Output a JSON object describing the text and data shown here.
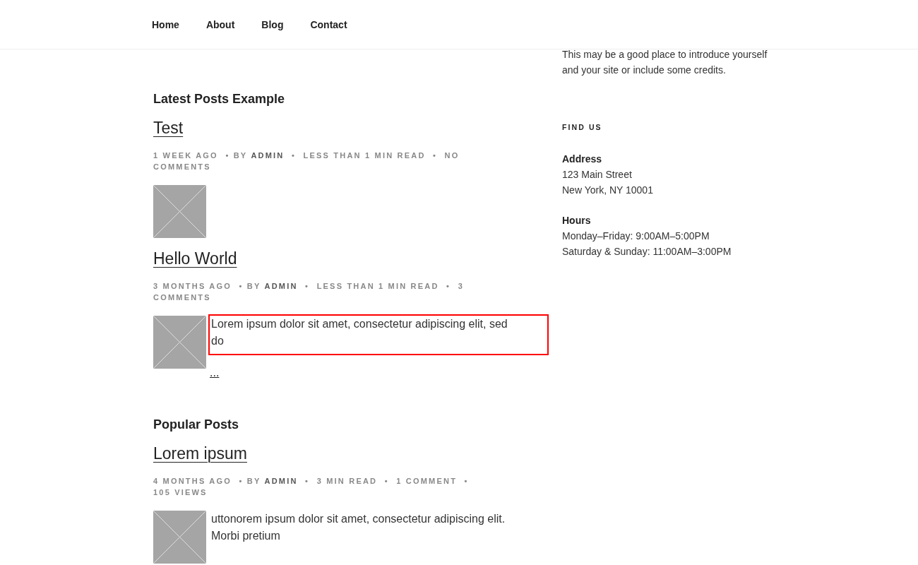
{
  "nav": {
    "items": [
      "Home",
      "About",
      "Blog",
      "Contact"
    ]
  },
  "sections": [
    {
      "heading": "Latest Posts Example",
      "posts": [
        {
          "title": "Test",
          "meta": "1 WEEK AGO  • BY **ADMIN**  •  LESS THAN 1 MIN READ  •  NO COMMENTS"
        },
        {
          "title": "Hello World",
          "meta": "3 MONTHS AGO  • BY **ADMIN**  •  LESS THAN 1 MIN READ  •  3 COMMENTS",
          "excerpt": "Lorem ipsum dolor sit amet, consectetur adipiscing elit, sed do",
          "more": "...",
          "highlighted": true
        }
      ]
    },
    {
      "heading": "Popular Posts",
      "posts": [
        {
          "title": "Lorem ipsum",
          "meta": "4 MONTHS AGO  • BY **ADMIN**  •  3 MIN READ  •  1 COMMENT  • 105 VIEWS",
          "excerpt": "uttonorem ipsum dolor sit amet, consectetur adipiscing elit. Morbi pretium"
        }
      ]
    }
  ],
  "sidebar": {
    "intro": "This may be a good place to introduce yourself and your site or include some credits.",
    "widget_title": "FIND US",
    "blocks": [
      {
        "heading": "Address",
        "lines": [
          "123 Main Street",
          "New York, NY 10001"
        ]
      },
      {
        "heading": "Hours",
        "lines": [
          "Monday–Friday: 9:00AM–5:00PM",
          "Saturday & Sunday: 11:00AM–3:00PM"
        ]
      }
    ]
  }
}
